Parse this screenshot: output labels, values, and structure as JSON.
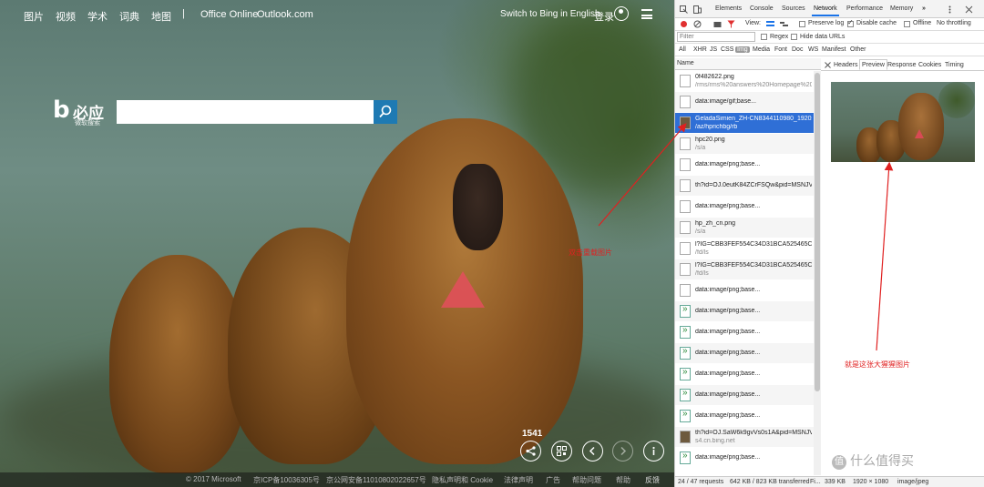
{
  "bing": {
    "nav": [
      "图片",
      "视频",
      "学术",
      "词典",
      "地图"
    ],
    "nav_sep": "|",
    "nav_links": [
      "Office Online",
      "Outlook.com"
    ],
    "switch_lang": "Switch to Bing in English",
    "login": "登录",
    "logo": {
      "mark": "b",
      "name": "必应",
      "sub": "微软搜索"
    },
    "search": {
      "value": "",
      "placeholder": ""
    },
    "image_count": "1541",
    "footer": [
      "© 2017 Microsoft",
      "京ICP备10036305号",
      "京公网安备11010802022657号",
      "隐私声明和 Cookie",
      "法律声明",
      "广告",
      "帮助问题",
      "帮助",
      "反馈"
    ],
    "annotation": "双击重载图片"
  },
  "devtools": {
    "tabs": [
      "Elements",
      "Console",
      "Sources",
      "Network",
      "Performance",
      "Memory",
      "»"
    ],
    "active_tab": "Network",
    "toolbar": {
      "view_label": "View:",
      "preserve_log": "Preserve log",
      "disable_cache": "Disable cache",
      "offline": "Offline",
      "throttling": "No throttling"
    },
    "filter": {
      "placeholder": "Filter",
      "regex": "Regex",
      "hide_data_urls": "Hide data URLs"
    },
    "types": [
      "All",
      "XHR",
      "JS",
      "CSS",
      "Img",
      "Media",
      "Font",
      "Doc",
      "WS",
      "Manifest",
      "Other"
    ],
    "active_type": "Img",
    "name_header": "Name",
    "requests": [
      {
        "name": "0f482622.png",
        "path": "/rms/rms%20answers%20Homepage%20Zi",
        "icon": "blank"
      },
      {
        "name": "data:image/gif;base...",
        "path": "",
        "icon": "blank"
      },
      {
        "name": "GeladaSimien_ZH-CN8344110980_1920x10",
        "path": "/az/hprichbg/rb",
        "icon": "image",
        "selected": true
      },
      {
        "name": "hpc20.png",
        "path": "/s/a",
        "icon": "blank"
      },
      {
        "name": "data:image/png;base...",
        "path": "",
        "icon": "blank"
      },
      {
        "name": "th?id=OJ.0eutK84ZCrFSQw&pid=MSNJVFe",
        "path": "",
        "icon": "blank"
      },
      {
        "name": "data:image/png;base...",
        "path": "",
        "icon": "blank"
      },
      {
        "name": "hp_zh_cn.png",
        "path": "/s/a",
        "icon": "blank"
      },
      {
        "name": "l?IG=CBB3FEF554C34D31BCA525465C415€",
        "path": "/fd/ls",
        "icon": "blank"
      },
      {
        "name": "l?IG=CBB3FEF554C34D31BCA525465C415€",
        "path": "/fd/ls",
        "icon": "blank"
      },
      {
        "name": "data:image/png;base...",
        "path": "",
        "icon": "blank"
      },
      {
        "name": "data:image/png;base...",
        "path": "",
        "icon": "green"
      },
      {
        "name": "data:image/png;base...",
        "path": "",
        "icon": "green"
      },
      {
        "name": "data:image/png;base...",
        "path": "",
        "icon": "green"
      },
      {
        "name": "data:image/png;base...",
        "path": "",
        "icon": "green"
      },
      {
        "name": "data:image/png;base...",
        "path": "",
        "icon": "green"
      },
      {
        "name": "data:image/png;base...",
        "path": "",
        "icon": "green"
      },
      {
        "name": "th?id=OJ.SaW6k9gvVs0s1A&pid=MSNJVFe",
        "path": "s4.cn.bing.net",
        "icon": "image"
      },
      {
        "name": "data:image/png;base...",
        "path": "",
        "icon": "green"
      }
    ],
    "detail_tabs": [
      "Headers",
      "Preview",
      "Response",
      "Cookies",
      "Timing"
    ],
    "active_detail_tab": "Preview",
    "annotation": "就是这张大猩猩图片",
    "status": {
      "requests": "24 / 47 requests",
      "transferred": "642 KB / 823 KB transferred",
      "fi": "Fi...",
      "size": "339 KB",
      "dims": "1920 × 1080",
      "mime": "image/jpeg"
    }
  },
  "watermark": {
    "badge": "值",
    "text": "什么值得买"
  },
  "colors": {
    "accent": "#1e7ab3",
    "selected_row": "#2f6fd6",
    "annotation": "#e02020"
  }
}
